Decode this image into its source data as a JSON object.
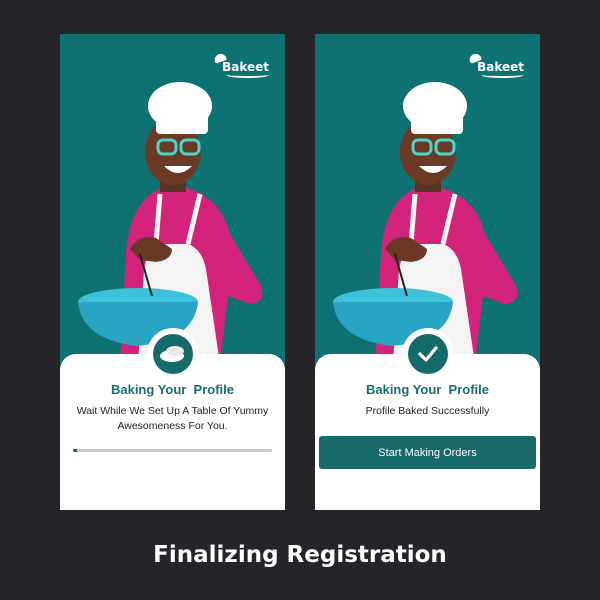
{
  "brand": {
    "name": "Bakeet"
  },
  "colors": {
    "background": "#25242b",
    "teal": "#0f7272",
    "accent": "#17696a",
    "pink": "#d4237a"
  },
  "screens": [
    {
      "title": "Baking Your  Profile",
      "message": "Wait While We Set Up A Table Of Yummy Awesomeness For You.",
      "icon": "dough-icon",
      "progress": 0.02
    },
    {
      "title": "Baking Your  Profile",
      "message": "Profile Baked Successfully",
      "icon": "check-icon",
      "button_label": "Start Making Orders"
    }
  ],
  "caption": "Finalizing Registration"
}
